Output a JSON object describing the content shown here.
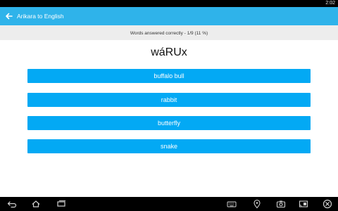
{
  "status": {
    "time": "2:02"
  },
  "app_bar": {
    "title": "Arikara to English",
    "back_icon": "arrow-left-icon"
  },
  "score": {
    "text": "Words answered correctly - 1/9 (11 %)"
  },
  "question": {
    "word": "wáRUx"
  },
  "answers": [
    {
      "label": "buffalo bull"
    },
    {
      "label": "rabbit"
    },
    {
      "label": "butterfly"
    },
    {
      "label": "snake"
    }
  ],
  "colors": {
    "app_bar": "#2fb3ea",
    "button": "#03a9f4",
    "score_bg": "#ededed"
  },
  "nav_bar": {
    "icons": [
      "back-icon",
      "home-icon",
      "recent-apps-icon",
      "keyboard-icon",
      "location-icon",
      "camera-icon",
      "screencast-icon",
      "close-icon"
    ]
  }
}
